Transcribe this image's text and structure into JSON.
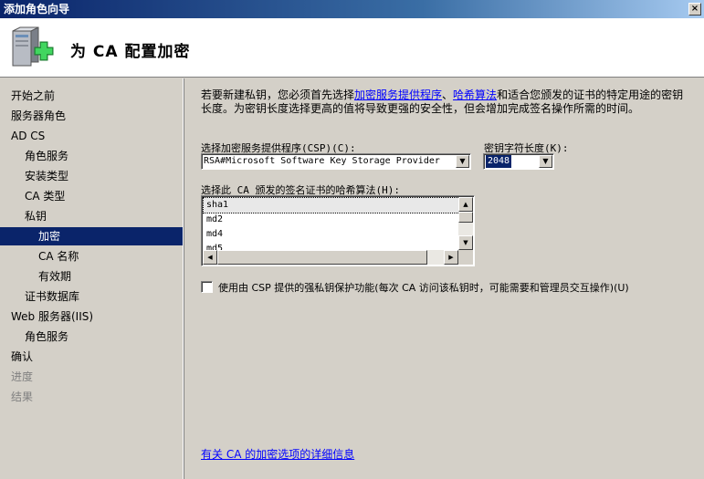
{
  "window": {
    "title": "添加角色向导",
    "close_glyph": "×"
  },
  "header": {
    "title": "为 CA 配置加密",
    "icon": "server-add-icon"
  },
  "sidebar": {
    "items": [
      {
        "label": "开始之前",
        "indent": 0,
        "state": "normal"
      },
      {
        "label": "服务器角色",
        "indent": 0,
        "state": "normal"
      },
      {
        "label": "AD CS",
        "indent": 0,
        "state": "normal"
      },
      {
        "label": "角色服务",
        "indent": 1,
        "state": "normal"
      },
      {
        "label": "安装类型",
        "indent": 1,
        "state": "normal"
      },
      {
        "label": "CA 类型",
        "indent": 1,
        "state": "normal"
      },
      {
        "label": "私钥",
        "indent": 1,
        "state": "normal"
      },
      {
        "label": "加密",
        "indent": 2,
        "state": "active"
      },
      {
        "label": "CA 名称",
        "indent": 2,
        "state": "normal"
      },
      {
        "label": "有效期",
        "indent": 2,
        "state": "normal"
      },
      {
        "label": "证书数据库",
        "indent": 1,
        "state": "normal"
      },
      {
        "label": "Web 服务器(IIS)",
        "indent": 0,
        "state": "normal"
      },
      {
        "label": "角色服务",
        "indent": 1,
        "state": "normal"
      },
      {
        "label": "确认",
        "indent": 0,
        "state": "normal"
      },
      {
        "label": "进度",
        "indent": 0,
        "state": "disabled"
      },
      {
        "label": "结果",
        "indent": 0,
        "state": "disabled"
      }
    ]
  },
  "main": {
    "desc_prefix": "若要新建私钥，您必须首先选择",
    "desc_link1": "加密服务提供程序",
    "desc_sep": "、",
    "desc_link2": "哈希算法",
    "desc_suffix": "和适合您颁发的证书的特定用途的密钥长度。为密钥长度选择更高的值将导致更强的安全性，但会增加完成签名操作所需的时间。",
    "csp_label": "选择加密服务提供程序(CSP)(C):",
    "csp_value": "RSA#Microsoft Software Key Storage Provider",
    "keylen_label": "密钥字符长度(K):",
    "keylen_value": "2048",
    "hash_label": "选择此 CA 颁发的签名证书的哈希算法(H):",
    "hash_options": [
      "sha1",
      "md2",
      "md4",
      "md5"
    ],
    "hash_selected": "sha1",
    "strong_protection_label": "使用由 CSP 提供的强私钥保护功能(每次 CA 访问该私钥时，可能需要和管理员交互操作)(U)",
    "strong_protection_checked": false,
    "help_link": "有关 CA 的加密选项的详细信息"
  }
}
